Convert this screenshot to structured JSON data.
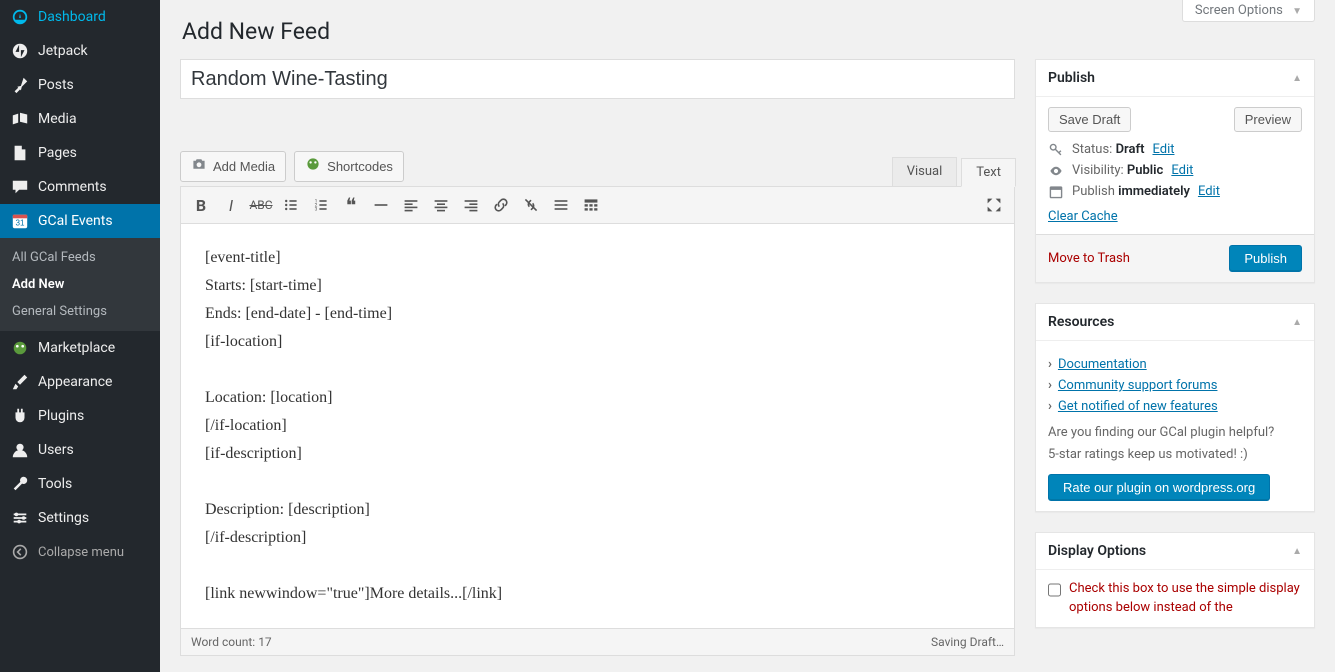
{
  "screen_options_label": "Screen Options",
  "page_title": "Add New Feed",
  "title_input_value": "Random Wine-Tasting",
  "sidebar": {
    "items": [
      {
        "label": "Dashboard"
      },
      {
        "label": "Jetpack"
      },
      {
        "label": "Posts"
      },
      {
        "label": "Media"
      },
      {
        "label": "Pages"
      },
      {
        "label": "Comments"
      },
      {
        "label": "GCal Events"
      },
      {
        "label": "Marketplace"
      },
      {
        "label": "Appearance"
      },
      {
        "label": "Plugins"
      },
      {
        "label": "Users"
      },
      {
        "label": "Tools"
      },
      {
        "label": "Settings"
      }
    ],
    "submenu": [
      {
        "label": "All GCal Feeds"
      },
      {
        "label": "Add New"
      },
      {
        "label": "General Settings"
      }
    ],
    "collapse_label": "Collapse menu"
  },
  "media_buttons": {
    "add_media": "Add Media",
    "shortcodes": "Shortcodes"
  },
  "editor_tabs": {
    "visual": "Visual",
    "text": "Text"
  },
  "editor_lines": [
    "[event-title]",
    "Starts: [start-time]",
    "Ends: [end-date] - [end-time]",
    "[if-location]",
    "",
    "Location: [location]",
    "[/if-location]",
    "[if-description]",
    "",
    "Description: [description]",
    "[/if-description]",
    "",
    "[link newwindow=\"true\"]More details...[/link]"
  ],
  "status_bar": {
    "word_count_label": "Word count: ",
    "word_count": "17",
    "saving": "Saving Draft…"
  },
  "publish": {
    "title": "Publish",
    "save_draft": "Save Draft",
    "preview": "Preview",
    "status_label": "Status:",
    "status_value": "Draft",
    "visibility_label": "Visibility:",
    "visibility_value": "Public",
    "schedule_label": "Publish",
    "schedule_value": "immediately",
    "edit": "Edit",
    "clear_cache": "Clear Cache",
    "move_trash": "Move to Trash",
    "publish_btn": "Publish"
  },
  "resources": {
    "title": "Resources",
    "links": [
      "Documentation",
      "Community support forums",
      "Get notified of new features"
    ],
    "help1": "Are you finding our GCal plugin helpful?",
    "help2": "5-star ratings keep us motivated! :)",
    "rate_btn": "Rate our plugin on wordpress.org"
  },
  "display_options": {
    "title": "Display Options",
    "checkbox_label": "Check this box to use the simple display options below instead of the"
  }
}
